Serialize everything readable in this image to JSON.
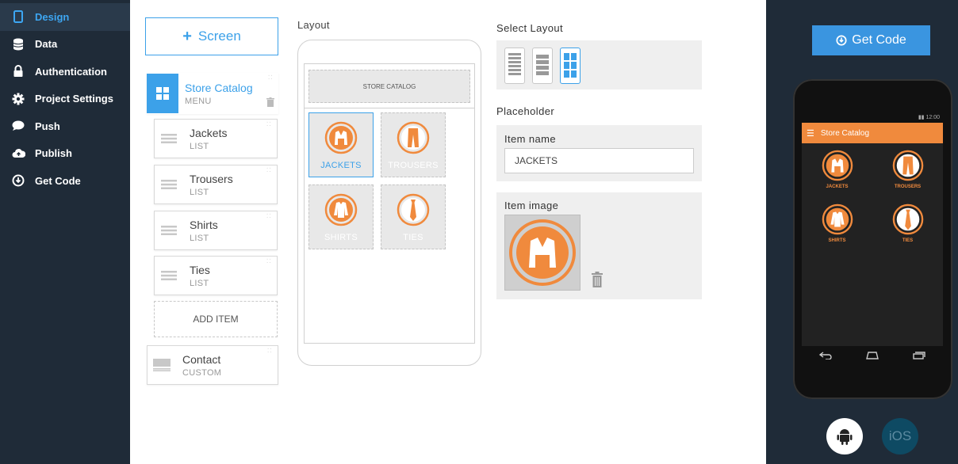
{
  "nav": {
    "items": [
      {
        "label": "Design",
        "icon": "phone-icon"
      },
      {
        "label": "Data",
        "icon": "database-icon"
      },
      {
        "label": "Authentication",
        "icon": "lock-icon"
      },
      {
        "label": "Project Settings",
        "icon": "gear-icon"
      },
      {
        "label": "Push",
        "icon": "chat-bubble-icon"
      },
      {
        "label": "Publish",
        "icon": "cloud-upload-icon"
      },
      {
        "label": "Get Code",
        "icon": "download-circle-icon"
      }
    ],
    "active": "Design"
  },
  "screens": {
    "add_label": "Screen",
    "menu": {
      "title": "Store Catalog",
      "type": "MENU"
    },
    "lists": [
      {
        "title": "Jackets",
        "type": "LIST"
      },
      {
        "title": "Trousers",
        "type": "LIST"
      },
      {
        "title": "Shirts",
        "type": "LIST"
      },
      {
        "title": "Ties",
        "type": "LIST"
      }
    ],
    "add_item_label": "ADD ITEM",
    "contact": {
      "title": "Contact",
      "type": "CUSTOM"
    }
  },
  "layout": {
    "label": "Layout",
    "header": "STORE CATALOG",
    "tiles": [
      "JACKETS",
      "TROUSERS",
      "SHIRTS",
      "TIES"
    ],
    "selected_tile": "JACKETS"
  },
  "settings": {
    "select_layout_label": "Select Layout",
    "placeholder_label": "Placeholder",
    "item_name_label": "Item name",
    "item_name_value": "JACKETS",
    "item_image_label": "Item image"
  },
  "preview": {
    "get_code_label": "Get Code",
    "status_time": "12:00",
    "app_title": "Store Catalog",
    "tiles": [
      "JACKETS",
      "TROUSERS",
      "SHIRTS",
      "TIES"
    ],
    "ios_label": "iOS"
  },
  "colors": {
    "accent_blue": "#3ca1e9",
    "orange": "#f08a3d",
    "nav_bg": "#1f2b38"
  }
}
